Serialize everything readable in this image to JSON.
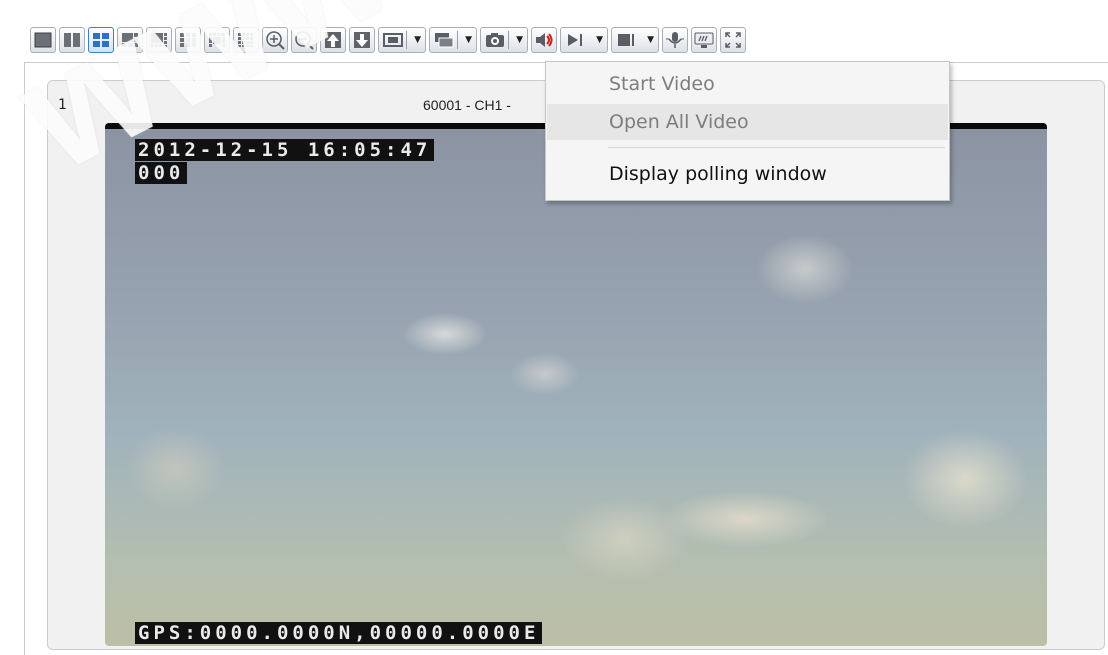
{
  "panel": {
    "cell_number": "1",
    "title": "60001 - CH1 -"
  },
  "video": {
    "osd_datetime": "2012-12-15 16:05:47",
    "osd_sub": "000",
    "osd_gps": "GPS:0000.0000N,00000.0000E"
  },
  "menu": {
    "start_video": "Start Video",
    "open_all_video": "Open All Video",
    "display_polling_window": "Display polling window"
  },
  "watermark": "www.bee",
  "colors": {
    "accent": "#3c7fd0",
    "menu_bg": "#f5f5f5",
    "menu_disabled_text": "#7d7d7d"
  }
}
